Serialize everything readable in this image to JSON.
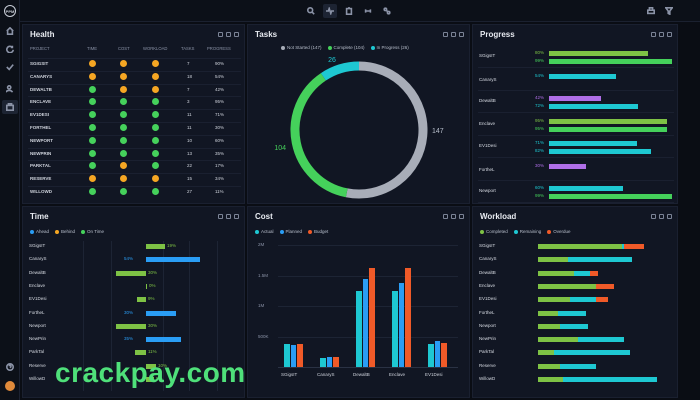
{
  "app": {
    "logo_text": "PPM"
  },
  "sidebar": {
    "items": [
      {
        "icon": "home-icon"
      },
      {
        "icon": "refresh-icon"
      },
      {
        "icon": "check-icon"
      },
      {
        "icon": "users-icon"
      },
      {
        "icon": "briefcase-icon"
      }
    ],
    "bottom": [
      {
        "icon": "help-icon"
      }
    ]
  },
  "topbar": {
    "items": [
      {
        "icon": "search-icon",
        "active": false
      },
      {
        "icon": "pulse-icon",
        "active": true
      },
      {
        "icon": "clipboard-icon",
        "active": false
      },
      {
        "icon": "link-icon",
        "active": false
      },
      {
        "icon": "share-icon",
        "active": false
      }
    ],
    "right": [
      {
        "icon": "print-icon"
      },
      {
        "icon": "filter-icon"
      }
    ]
  },
  "colors": {
    "green": "#45d15b",
    "orange": "#f5a623",
    "cyan": "#1ec8d2",
    "blue": "#2a9df4",
    "purple": "#b06fe8",
    "red": "#f05a28",
    "gray": "#a8adb8",
    "lime": "#7ec245"
  },
  "health": {
    "title": "Health",
    "headers": [
      "PROJECT",
      "TIME",
      "COST",
      "WORKLOAD",
      "TASKS",
      "PROGRESS"
    ],
    "rows": [
      {
        "project": "SGIGSIT",
        "time": "orange",
        "cost": "orange",
        "workload": "orange",
        "tasks": "7",
        "progress": "90%"
      },
      {
        "project": "CANARYS",
        "time": "orange",
        "cost": "orange",
        "workload": "orange",
        "tasks": "18",
        "progress": "54%"
      },
      {
        "project": "DEWALTB",
        "time": "green",
        "cost": "orange",
        "workload": "orange",
        "tasks": "7",
        "progress": "42%"
      },
      {
        "project": "ENCLAVE",
        "time": "green",
        "cost": "green",
        "workload": "green",
        "tasks": "3",
        "progress": "95%"
      },
      {
        "project": "EV1DESI",
        "time": "green",
        "cost": "green",
        "workload": "green",
        "tasks": "11",
        "progress": "71%"
      },
      {
        "project": "FORTHEL",
        "time": "green",
        "cost": "green",
        "workload": "green",
        "tasks": "11",
        "progress": "30%"
      },
      {
        "project": "NEWPORT",
        "time": "green",
        "cost": "green",
        "workload": "green",
        "tasks": "10",
        "progress": "60%"
      },
      {
        "project": "NEWPRIN",
        "time": "green",
        "cost": "green",
        "workload": "green",
        "tasks": "13",
        "progress": "35%"
      },
      {
        "project": "PARKTAL",
        "time": "green",
        "cost": "orange",
        "workload": "green",
        "tasks": "22",
        "progress": "17%"
      },
      {
        "project": "RESERVE",
        "time": "orange",
        "cost": "orange",
        "workload": "orange",
        "tasks": "15",
        "progress": "34%"
      },
      {
        "project": "WILLOWD",
        "time": "green",
        "cost": "green",
        "workload": "green",
        "tasks": "27",
        "progress": "11%"
      }
    ]
  },
  "tasks": {
    "title": "Tasks",
    "legend": [
      {
        "label": "Not Started (147)",
        "color": "#a8adb8"
      },
      {
        "label": "Complete (104)",
        "color": "#45d15b"
      },
      {
        "label": "In Progress (26)",
        "color": "#1ec8d2"
      }
    ],
    "chart_data": {
      "type": "pie",
      "categories": [
        "Not Started",
        "Complete",
        "In Progress"
      ],
      "values": [
        147,
        104,
        26
      ],
      "labels": [
        "147",
        "104",
        "26"
      ]
    }
  },
  "progress": {
    "title": "Progress",
    "chart_data": {
      "type": "bar",
      "orientation": "horizontal",
      "categories": [
        "SGigsIT",
        "CanaryS",
        "DewaltB",
        "Enclave",
        "EV1Desi",
        "FortheL",
        "Newport"
      ],
      "series": [
        {
          "values": [
            80,
            99
          ]
        },
        {
          "values": [
            54,
            0
          ]
        },
        {
          "values": [
            42,
            72
          ]
        },
        {
          "values": [
            95,
            95
          ]
        },
        {
          "values": [
            71,
            82
          ]
        },
        {
          "values": [
            30,
            0
          ]
        },
        {
          "values": [
            60,
            99
          ]
        }
      ],
      "bars": [
        {
          "project": "SGigsIT",
          "a": {
            "v": 80,
            "c": "lime"
          },
          "b": {
            "v": 99,
            "c": "green"
          }
        },
        {
          "project": "CanaryS",
          "a": {
            "v": 54,
            "c": "cyan"
          },
          "b": null
        },
        {
          "project": "DewaltB",
          "a": {
            "v": 42,
            "c": "purple"
          },
          "b": {
            "v": 72,
            "c": "cyan"
          }
        },
        {
          "project": "Enclave",
          "a": {
            "v": 95,
            "c": "lime"
          },
          "b": {
            "v": 95,
            "c": "green"
          }
        },
        {
          "project": "EV1Desi",
          "a": {
            "v": 71,
            "c": "cyan"
          },
          "b": {
            "v": 82,
            "c": "cyan"
          }
        },
        {
          "project": "FortheL",
          "a": {
            "v": 30,
            "c": "purple"
          },
          "b": null
        },
        {
          "project": "Newport",
          "a": {
            "v": 60,
            "c": "cyan"
          },
          "b": {
            "v": 99,
            "c": "green"
          }
        }
      ]
    }
  },
  "time": {
    "title": "Time",
    "legend": [
      {
        "label": "Ahead",
        "color": "#2a9df4"
      },
      {
        "label": "Behind",
        "color": "#f5a623"
      },
      {
        "label": "On Time",
        "color": "#45d15b"
      }
    ],
    "chart_data": {
      "type": "bar",
      "orientation": "horizontal",
      "categories": [
        "SGigsIT",
        "CanaryS",
        "DewaltB",
        "Enclave",
        "EV1Desi",
        "FortheL",
        "Newport",
        "NewPrin",
        "ParkTal",
        "Reserve",
        "WillowD"
      ],
      "values": [
        19,
        54,
        30,
        0,
        9,
        30,
        30,
        35,
        11,
        10,
        8
      ],
      "rows": [
        {
          "project": "SGigsIT",
          "v": 19,
          "c": "lime",
          "dir": 1
        },
        {
          "project": "CanaryS",
          "v": 54,
          "c": "blue",
          "dir": 1
        },
        {
          "project": "DewaltB",
          "v": 30,
          "c": "lime",
          "dir": -1
        },
        {
          "project": "Enclave",
          "v": 0,
          "c": "lime",
          "dir": 1
        },
        {
          "project": "EV1Desi",
          "v": 9,
          "c": "lime",
          "dir": -1
        },
        {
          "project": "FortheL",
          "v": 30,
          "c": "blue",
          "dir": 1
        },
        {
          "project": "Newport",
          "v": 30,
          "c": "lime",
          "dir": -1
        },
        {
          "project": "NewPrin",
          "v": 35,
          "c": "blue",
          "dir": 1
        },
        {
          "project": "ParkTal",
          "v": 11,
          "c": "lime",
          "dir": -1
        },
        {
          "project": "Reserve",
          "v": 10,
          "c": "lime",
          "dir": 1
        },
        {
          "project": "WillowD",
          "v": 8,
          "c": "lime",
          "dir": 1
        }
      ]
    }
  },
  "cost": {
    "title": "Cost",
    "legend": [
      {
        "label": "Actual",
        "color": "#1ec8d2"
      },
      {
        "label": "Planned",
        "color": "#2a9df4"
      },
      {
        "label": "Budget",
        "color": "#f05a28"
      }
    ],
    "chart_data": {
      "type": "bar",
      "categories": [
        "SGigsIT",
        "CanaryS",
        "DewaltB",
        "Enclave",
        "EV1Desi"
      ],
      "series": [
        {
          "name": "Actual",
          "values": [
            380000,
            140000,
            1250000,
            1250000,
            370000
          ]
        },
        {
          "name": "Planned",
          "values": [
            360000,
            160000,
            1450000,
            1380000,
            430000
          ]
        },
        {
          "name": "Budget",
          "values": [
            380000,
            170000,
            1620000,
            1620000,
            390000
          ]
        }
      ],
      "ylim": [
        0,
        2000000
      ],
      "yticks": [
        "2M",
        "1.5M",
        "1M",
        "500K"
      ]
    }
  },
  "workload": {
    "title": "Workload",
    "legend": [
      {
        "label": "Completed",
        "color": "#7ec245"
      },
      {
        "label": "Remaining",
        "color": "#1ec8d2"
      },
      {
        "label": "Overdue",
        "color": "#f05a28"
      }
    ],
    "chart_data": {
      "type": "bar",
      "stacked": true,
      "orientation": "horizontal",
      "categories": [
        "SGigsIT",
        "CanaryS",
        "DewaltB",
        "Enclave",
        "EV1Desi",
        "FortheL",
        "Newport",
        "NewPrin",
        "ParkTal",
        "Reserve",
        "WillowD"
      ],
      "series": [
        {
          "name": "Completed",
          "values": [
            84,
            30,
            36,
            58,
            32,
            20,
            22,
            40,
            16,
            22,
            25
          ]
        },
        {
          "name": "Remaining",
          "values": [
            2,
            64,
            16,
            0,
            26,
            28,
            28,
            46,
            76,
            36,
            94
          ]
        },
        {
          "name": "Overdue",
          "values": [
            20,
            0,
            8,
            18,
            12,
            0,
            0,
            0,
            0,
            0,
            0
          ]
        }
      ]
    }
  },
  "watermark": "crackpay.com"
}
